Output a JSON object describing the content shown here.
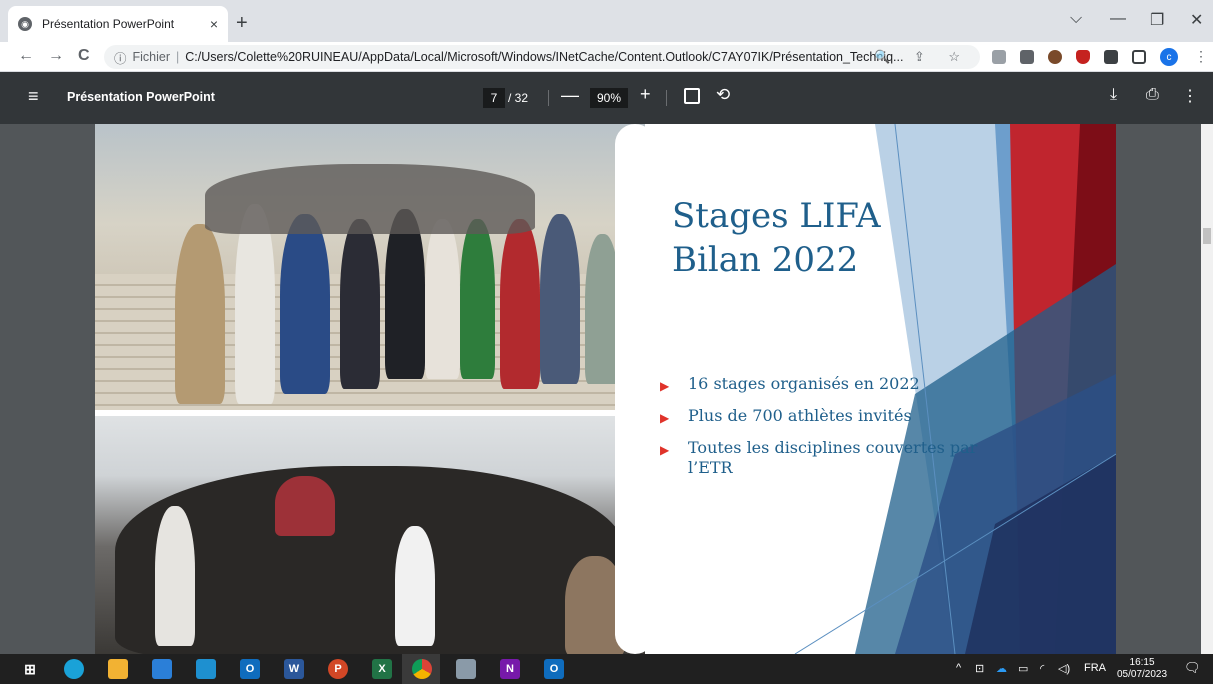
{
  "browser": {
    "tab_title": "Présentation PowerPoint",
    "tab_close": "×",
    "new_tab": "+",
    "window_controls": {
      "tabsearch": "⌵",
      "minimize": "—",
      "restore": "❐",
      "close": "✕"
    },
    "address": {
      "info_icon": "ⓘ",
      "scheme_label": "Fichier",
      "separator": "|",
      "url": "C:/Users/Colette%20RUINEAU/AppData/Local/Microsoft/Windows/INetCache/Content.Outlook/C7AY07IK/Présentation_Techniq...",
      "icons": "🔍 ⇪ ☆"
    },
    "profile_initial": "c",
    "menu": "⋮",
    "nav": {
      "back": "←",
      "forward": "→",
      "reload": "C"
    }
  },
  "pdf": {
    "menu_icon": "≡",
    "title": "Présentation PowerPoint",
    "page_current": "7",
    "page_total": "/ 32",
    "zoom_minus": "—",
    "zoom": "90%",
    "zoom_plus": "+",
    "rotate_icon": "⟲",
    "download_icon": "⤓",
    "print_icon": "⎙",
    "more_icon": "⋮"
  },
  "slide": {
    "title": "Stages LIFA\nBilan 2022",
    "bullets": [
      "16 stages organisés en 2022",
      "Plus de 700 athlètes invités",
      "Toutes les disciplines couvertes par l’ETR"
    ],
    "bullet_marker": "▶",
    "colors": {
      "title": "#1f5f8b",
      "bullet_marker": "#e0332a",
      "dark_red": "#8b0f1a",
      "blue": "#1f5f8b"
    }
  },
  "taskbar": {
    "apps": [
      "start",
      "edge",
      "file-explorer",
      "store",
      "app",
      "outlook",
      "word",
      "powerpoint",
      "excel",
      "chrome",
      "app-2",
      "onenote",
      "outlook-2"
    ],
    "tray": {
      "up_arrow": "^",
      "language": "FRA"
    },
    "time": "16:15",
    "date": "05/07/2023",
    "notification_icon": "🗨"
  }
}
